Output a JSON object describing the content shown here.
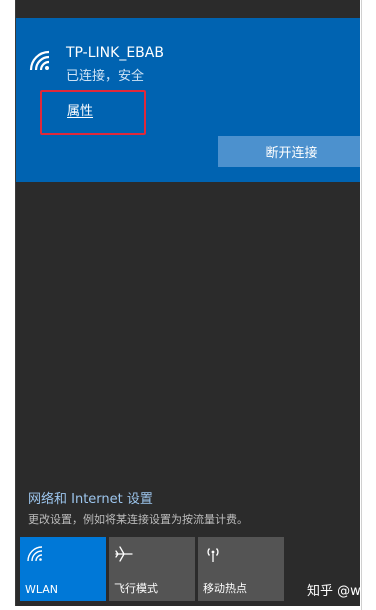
{
  "network": {
    "ssid": "TP-LINK_EBAB",
    "status": "已连接，安全",
    "properties_label": "属性",
    "disconnect_label": "断开连接",
    "icon": "wifi-icon"
  },
  "settings": {
    "link_label": "网络和 Internet 设置",
    "description": "更改设置，例如将某连接设置为按流量计费。"
  },
  "tiles": [
    {
      "label": "WLAN",
      "icon": "wifi-icon",
      "active": true
    },
    {
      "label": "飞行模式",
      "icon": "airplane-icon",
      "active": false
    },
    {
      "label": "移动热点",
      "icon": "hotspot-icon",
      "active": false
    }
  ],
  "watermark": "知乎 @wuls",
  "colors": {
    "flyout_bg": "#2b2b2b",
    "network_card": "#0063b1",
    "disconnect_button": "#4c91ce",
    "tile_active": "#0078d7",
    "tile_inactive": "#545454",
    "highlight_box": "#e0293a",
    "settings_link": "#9dc6ee"
  }
}
